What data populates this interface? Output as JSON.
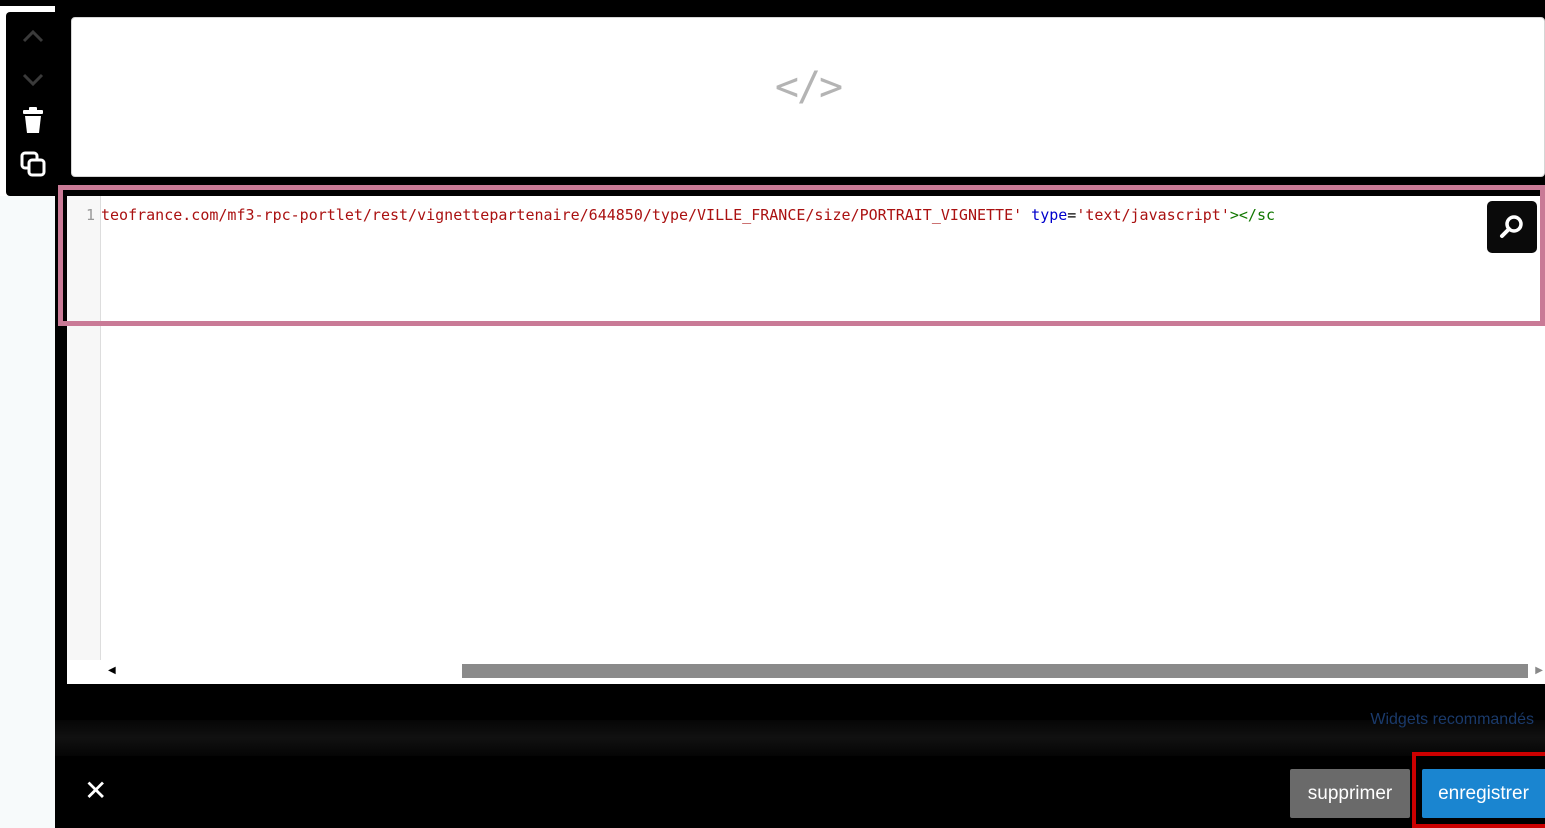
{
  "editor": {
    "line_number": "1",
    "code": {
      "url_part": "teofrance.com/mf3-rpc-portlet/rest/vignettepartenaire/644850/type/VILLE_FRANCE/size/PORTRAIT_VIGNETTE'",
      "attr_name": "type",
      "equals": "=",
      "attr_value": "'text/javascript'",
      "closing": "></sc"
    }
  },
  "preview": {
    "icon": "code-icon",
    "glyph": "</>"
  },
  "toolbar": {
    "icons": [
      "chevron-up-icon",
      "chevron-down-icon",
      "trash-icon",
      "copy-icon"
    ]
  },
  "footer": {
    "widgets_link": "Widgets recommandés",
    "delete_label": "supprimer",
    "save_label": "enregistrer",
    "close_glyph": "✕"
  },
  "colors": {
    "highlight_pink": "#c97a96",
    "save_blue": "#1a85d0",
    "delete_gray": "#6a6a6a",
    "save_highlight_red": "#cc0000"
  }
}
